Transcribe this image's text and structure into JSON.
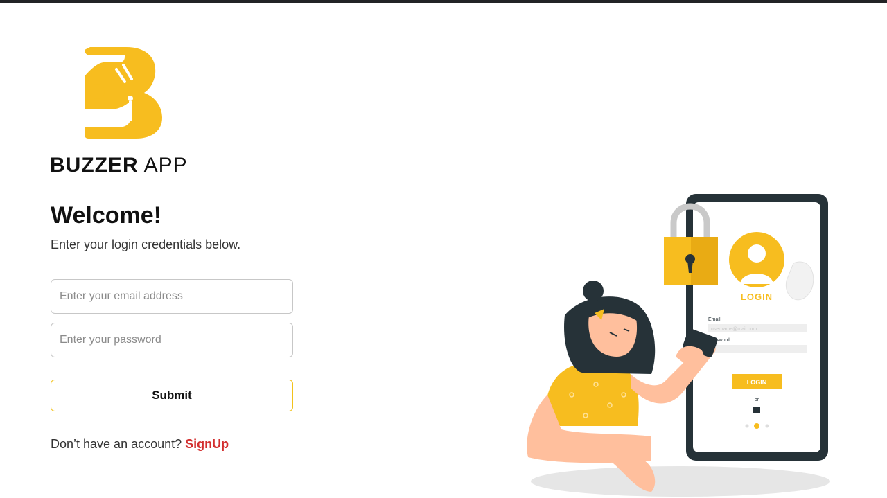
{
  "brand": {
    "name_bold": "BUZZER",
    "name_light": "APP"
  },
  "login": {
    "title": "Welcome!",
    "subtitle": "Enter your login credentials below.",
    "email_placeholder": "Enter your email address",
    "password_placeholder": "Enter your password",
    "submit_label": "Submit",
    "signup_prompt": "Don’t have an account?",
    "signup_link": "SignUp"
  },
  "illustration": {
    "phone_login_heading": "LOGIN",
    "phone_email_label": "Email",
    "phone_email_placeholder": "username@mail.com",
    "phone_password_label": "Password",
    "phone_login_button": "LOGIN",
    "phone_or": "or"
  },
  "colors": {
    "accent": "#f7bd1f",
    "link": "#d32f2f",
    "dark": "#263238",
    "skin": "#ffbf9d"
  }
}
